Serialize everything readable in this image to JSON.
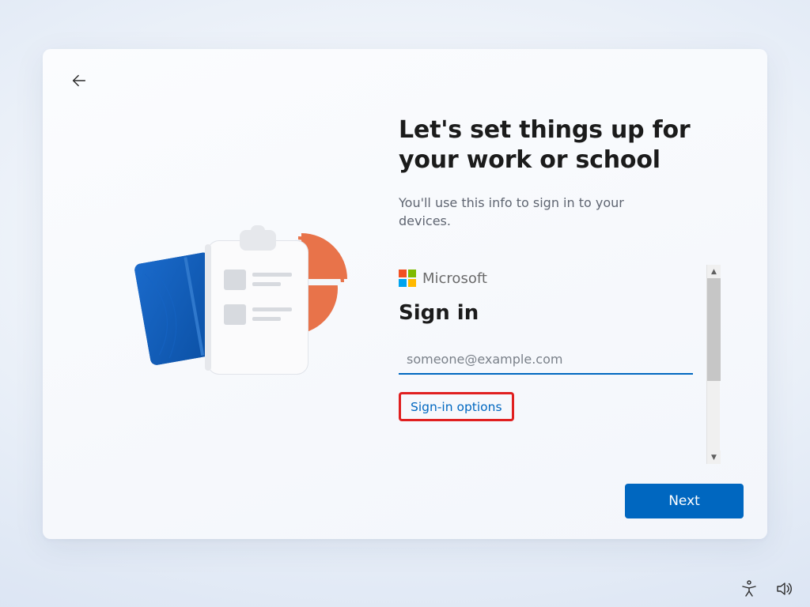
{
  "page": {
    "title": "Let's set things up for your work or school",
    "subtitle": "You'll use this info to sign in to your devices."
  },
  "signin": {
    "brand": "Microsoft",
    "heading": "Sign in",
    "email_placeholder": "someone@example.com",
    "options_label": "Sign-in options"
  },
  "buttons": {
    "next": "Next"
  },
  "icons": {
    "back": "back-arrow",
    "accessibility": "accessibility-figure",
    "volume": "speaker"
  },
  "colors": {
    "accent": "#0067c0",
    "highlight_border": "#e02020"
  }
}
